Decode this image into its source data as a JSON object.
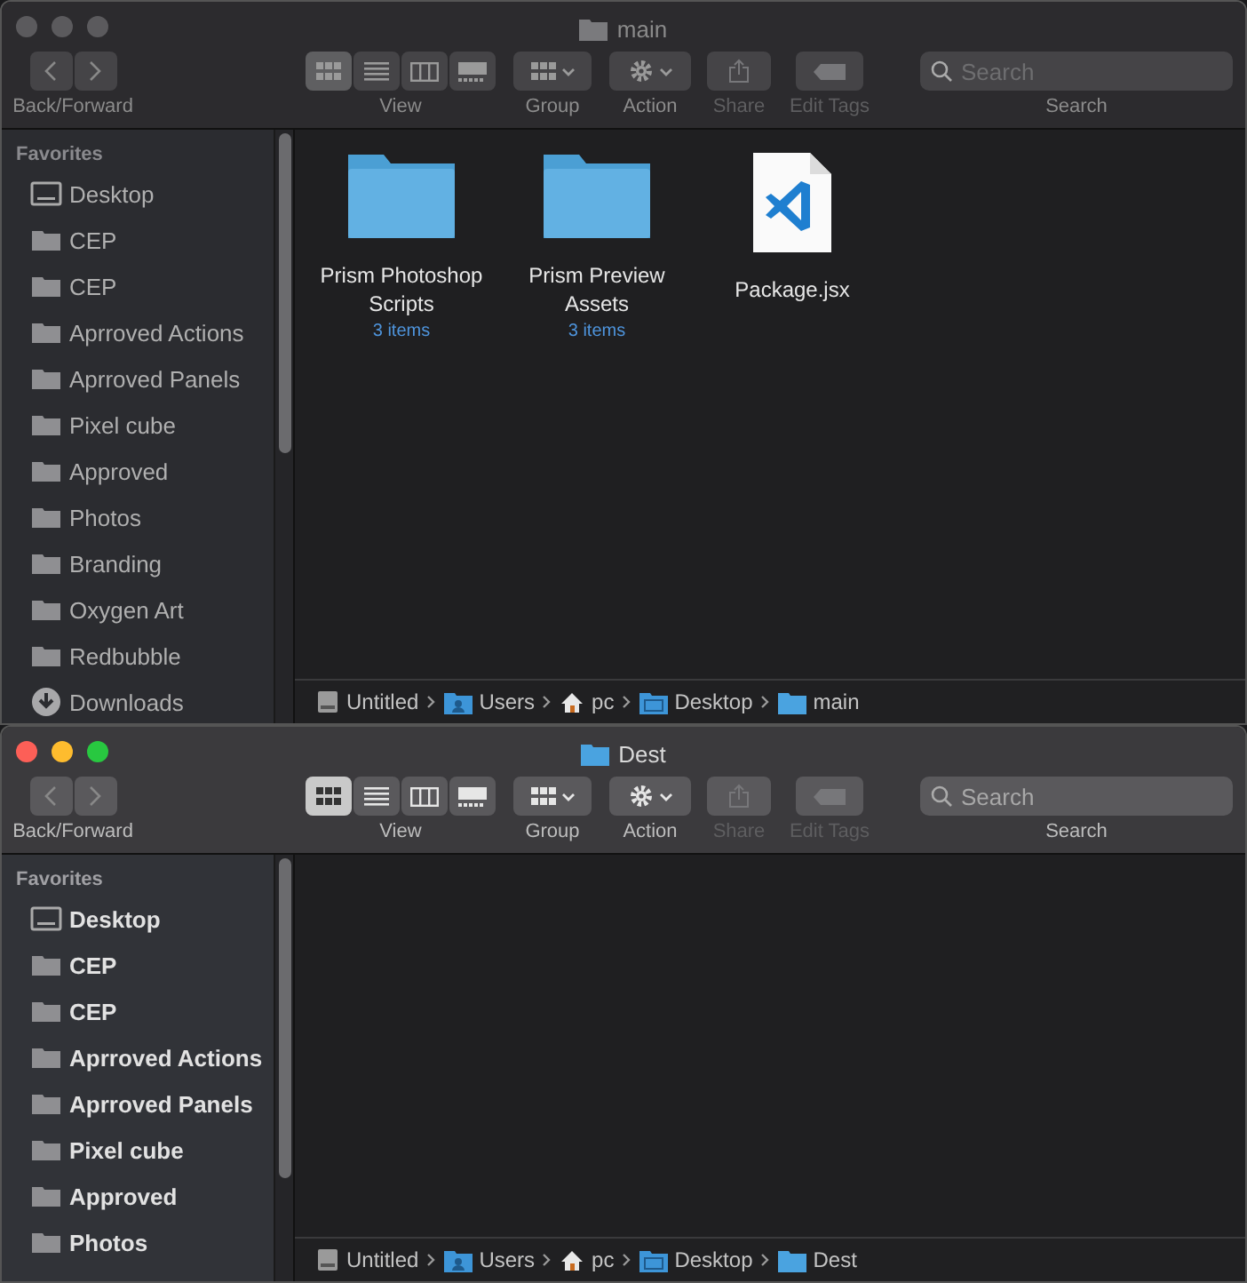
{
  "windows": [
    {
      "title": "main",
      "active": false,
      "toolbar": {
        "nav_label": "Back/Forward",
        "view": {
          "label": "View",
          "options": [
            {
              "kind": "icons",
              "selected": true
            },
            {
              "kind": "list",
              "selected": false
            },
            {
              "kind": "columns",
              "selected": false
            },
            {
              "kind": "gallery",
              "selected": false
            }
          ]
        },
        "group": "Group",
        "action": "Action",
        "share": {
          "label": "Share",
          "disabled": true
        },
        "edit_tags": {
          "label": "Edit Tags",
          "disabled": true
        },
        "search": {
          "placeholder": "Search",
          "label": "Search"
        }
      },
      "sidebar": {
        "heading": "Favorites",
        "items": [
          {
            "kind": "desktop",
            "label": "Desktop"
          },
          {
            "kind": "folder",
            "label": "CEP"
          },
          {
            "kind": "folder",
            "label": "CEP"
          },
          {
            "kind": "folder",
            "label": "Aprroved Actions"
          },
          {
            "kind": "folder",
            "label": "Aprroved Panels"
          },
          {
            "kind": "folder",
            "label": "Pixel cube"
          },
          {
            "kind": "folder",
            "label": "Approved"
          },
          {
            "kind": "folder",
            "label": "Photos"
          },
          {
            "kind": "folder",
            "label": "Branding"
          },
          {
            "kind": "folder",
            "label": "Oxygen Art"
          },
          {
            "kind": "folder",
            "label": "Redbubble"
          },
          {
            "kind": "downloads",
            "label": "Downloads"
          }
        ]
      },
      "items": [
        {
          "kind": "folder",
          "name": "Prism Photoshop Scripts",
          "count": "3 items"
        },
        {
          "kind": "folder",
          "name": "Prism Preview Assets",
          "count": "3 items"
        },
        {
          "kind": "code",
          "name": "Package.jsx"
        }
      ],
      "path": [
        {
          "kind": "disk",
          "label": "Untitled"
        },
        {
          "kind": "users",
          "label": "Users"
        },
        {
          "kind": "home",
          "label": "pc"
        },
        {
          "kind": "desktop",
          "label": "Desktop"
        },
        {
          "kind": "folder",
          "label": "main"
        }
      ]
    },
    {
      "title": "Dest",
      "active": true,
      "toolbar": {
        "nav_label": "Back/Forward",
        "view": {
          "label": "View",
          "options": [
            {
              "kind": "icons",
              "selected": true
            },
            {
              "kind": "list",
              "selected": false
            },
            {
              "kind": "columns",
              "selected": false
            },
            {
              "kind": "gallery",
              "selected": false
            }
          ]
        },
        "group": "Group",
        "action": "Action",
        "share": {
          "label": "Share",
          "disabled": true
        },
        "edit_tags": {
          "label": "Edit Tags",
          "disabled": true
        },
        "search": {
          "placeholder": "Search",
          "label": "Search"
        }
      },
      "sidebar": {
        "heading": "Favorites",
        "items": [
          {
            "kind": "desktop",
            "label": "Desktop"
          },
          {
            "kind": "folder",
            "label": "CEP"
          },
          {
            "kind": "folder",
            "label": "CEP"
          },
          {
            "kind": "folder",
            "label": "Aprroved Actions"
          },
          {
            "kind": "folder",
            "label": "Aprroved Panels"
          },
          {
            "kind": "folder",
            "label": "Pixel cube"
          },
          {
            "kind": "folder",
            "label": "Approved"
          },
          {
            "kind": "folder",
            "label": "Photos"
          }
        ]
      },
      "path": [
        {
          "kind": "disk",
          "label": "Untitled"
        },
        {
          "kind": "users",
          "label": "Users"
        },
        {
          "kind": "home",
          "label": "pc"
        },
        {
          "kind": "desktop",
          "label": "Desktop"
        },
        {
          "kind": "folder",
          "label": "Dest"
        }
      ]
    }
  ]
}
